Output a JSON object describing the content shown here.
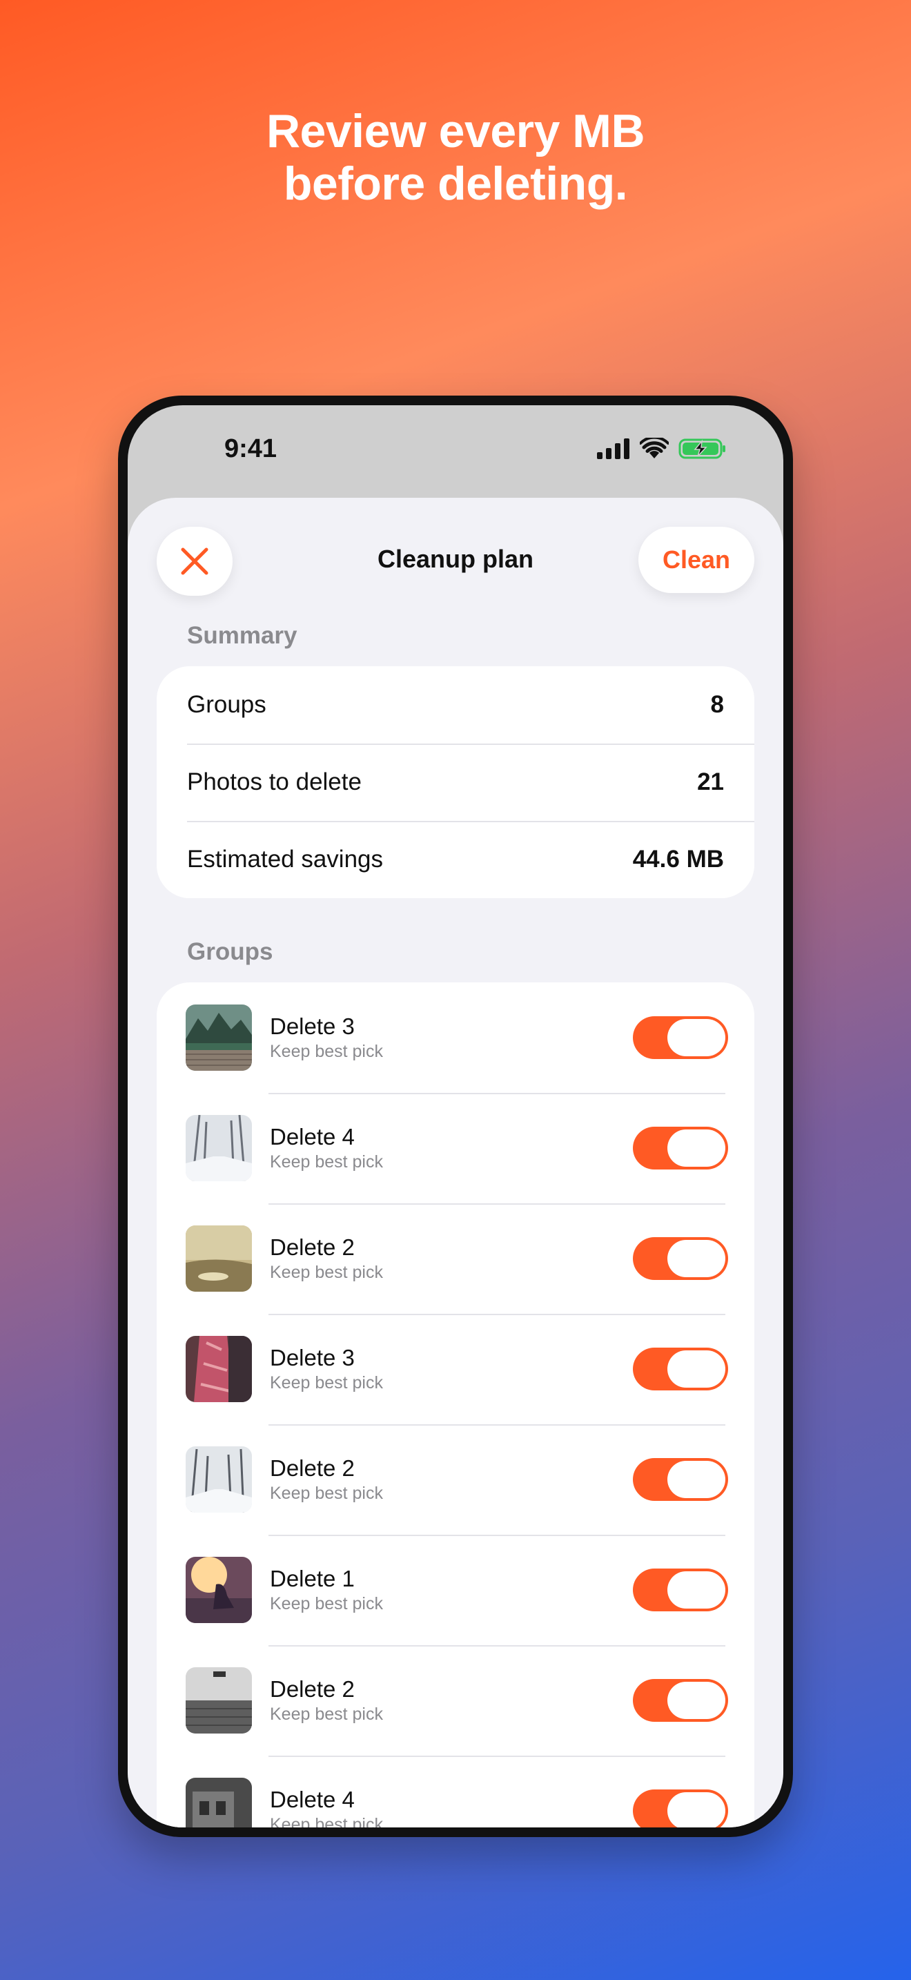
{
  "headline": {
    "line1": "Review every MB",
    "line2": "before deleting."
  },
  "status_bar": {
    "time": "9:41",
    "icons": [
      "signal-icon",
      "wifi-icon",
      "battery-charging-icon"
    ]
  },
  "nav": {
    "title": "Cleanup plan",
    "close_icon": "close-icon",
    "action_label": "Clean"
  },
  "colors": {
    "accent": "#ff5a24",
    "background_top": "#ff5a24",
    "background_bottom": "#2563eb"
  },
  "summary": {
    "header": "Summary",
    "rows": [
      {
        "label": "Groups",
        "value": "8"
      },
      {
        "label": "Photos to delete",
        "value": "21"
      },
      {
        "label": "Estimated savings",
        "value": "44.6 MB"
      }
    ]
  },
  "groups": {
    "header": "Groups",
    "items": [
      {
        "title": "Delete 3",
        "subtitle": "Keep best pick",
        "enabled": true
      },
      {
        "title": "Delete 4",
        "subtitle": "Keep best pick",
        "enabled": true
      },
      {
        "title": "Delete 2",
        "subtitle": "Keep best pick",
        "enabled": true
      },
      {
        "title": "Delete 3",
        "subtitle": "Keep best pick",
        "enabled": true
      },
      {
        "title": "Delete 2",
        "subtitle": "Keep best pick",
        "enabled": true
      },
      {
        "title": "Delete 1",
        "subtitle": "Keep best pick",
        "enabled": true
      },
      {
        "title": "Delete 2",
        "subtitle": "Keep best pick",
        "enabled": true
      },
      {
        "title": "Delete 4",
        "subtitle": "Keep best pick",
        "enabled": true
      }
    ]
  }
}
